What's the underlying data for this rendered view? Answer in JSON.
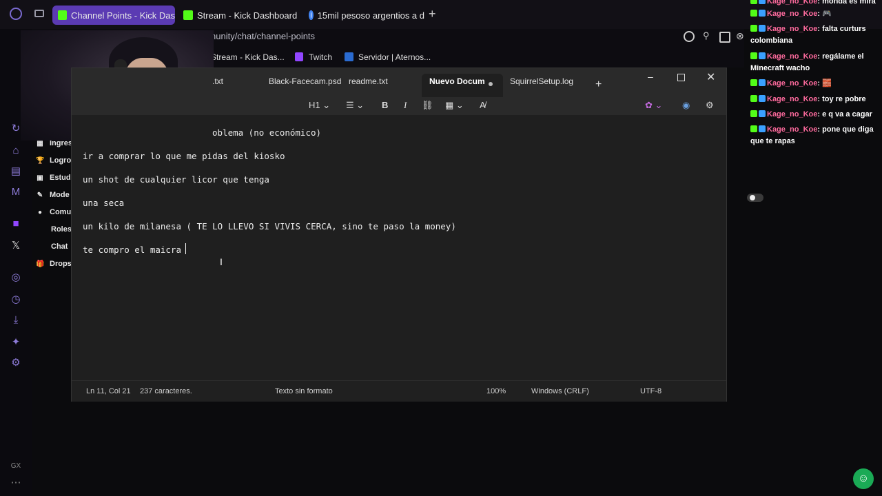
{
  "browser": {
    "tabs": [
      {
        "label": "Channel Points - Kick Das",
        "active": true,
        "icon": "kick-icon"
      },
      {
        "label": "Stream - Kick Dashboard",
        "active": false,
        "icon": "kick-icon"
      },
      {
        "label": "15mil pesoso argentios a d",
        "active": false,
        "icon": "google-icon"
      }
    ],
    "new_tab": "+",
    "address": "nunity/chat/channel-points",
    "bookmarks": [
      "Stream - Kick Das...",
      "Twitch",
      "Servidor | Aternos..."
    ]
  },
  "dashboard_nav": [
    "Ingres",
    "Logro",
    "Estud",
    "Mode",
    "Comu",
    "Roles",
    "Chat",
    "Drops"
  ],
  "gx_label": "GX",
  "chat": [
    {
      "user": "Kage_no_Koe",
      "msg": ": mondá es mira"
    },
    {
      "user": "Kage_no_Koe",
      "msg": ": 🎮"
    },
    {
      "user": "Kage_no_Koe",
      "msg": ": falta curturs colombiana"
    },
    {
      "user": "Kage_no_Koe",
      "msg": ": regálame el Minecraft wacho"
    },
    {
      "user": "Kage_no_Koe",
      "msg": ": 🧱"
    },
    {
      "user": "Kage_no_Koe",
      "msg": ": toy re pobre"
    },
    {
      "user": "Kage_no_Koe",
      "msg": ": e q va a cagar"
    },
    {
      "user": "Kage_no_Koe",
      "msg": ": pone que diga que te rapas"
    }
  ],
  "notepad": {
    "tabs": [
      ".txt",
      "Black-Facecam.psd",
      "readme.txt",
      "Nuevo Docum",
      "SquirrelSetup.log"
    ],
    "active_tab": "Nuevo Docum",
    "toolbar": {
      "heading": "H1",
      "bold": "B",
      "italic": "I"
    },
    "lines": [
      "oblema (no económico)",
      "ir a comprar lo que me pidas del kiosko",
      "un shot de cualquier licor que tenga",
      "una seca",
      "un kilo de milanesa ( TE LO LLEVO SI VIVIS CERCA, sino te paso la money)",
      "te compro el maicra "
    ],
    "status": {
      "position": "Ln 11, Col 21",
      "chars": "237 caracteres.",
      "format": "Texto sin formato",
      "zoom": "100%",
      "eol": "Windows (CRLF)",
      "encoding": "UTF-8"
    }
  }
}
